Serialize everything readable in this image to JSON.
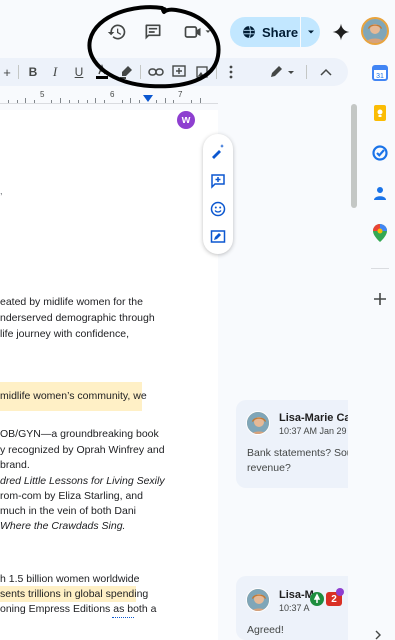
{
  "topbar": {
    "share_label": "Share",
    "icons": [
      "history-icon",
      "comment-icon",
      "video-icon",
      "sparkle-icon"
    ]
  },
  "toolbar": {
    "items": [
      "+",
      "B",
      "I",
      "U",
      "A",
      "highlighter",
      "link",
      "add-comment",
      "image",
      "more",
      "edit-mode",
      "collapse"
    ]
  },
  "ruler": {
    "numbers": [
      "5",
      "6",
      "7"
    ]
  },
  "floating_badge": "w",
  "document": {
    "lines": [
      {
        "text": "eated by midlife women for the",
        "highlight": false,
        "italic": false
      },
      {
        "text": "nderserved demographic through",
        "highlight": false,
        "italic": false
      },
      {
        "text": "life journey with confidence,",
        "highlight": false,
        "italic": false
      },
      {
        "text": " midlife women’s community, we",
        "highlight": true,
        "italic": false
      },
      {
        "text": " OB/GYN—a groundbreaking book",
        "highlight": false,
        "italic": false
      },
      {
        "text": "y recognized by Oprah Winfrey and",
        "highlight": false,
        "italic": false
      },
      {
        "text": "brand.",
        "highlight": false,
        "italic": false
      },
      {
        "text": "dred Little Lessons for Living Sexily",
        "highlight": false,
        "italic": true
      },
      {
        "text": " rom-com by Eliza Starling, and",
        "highlight": false,
        "italic": false
      },
      {
        "text": " much in the vein of both Dani",
        "highlight": false,
        "italic": false
      },
      {
        "text": "Where the Crawdads Sing.",
        "highlight": false,
        "italic": true
      },
      {
        "text": "h 1.5 billion women worldwide",
        "highlight": false,
        "italic": false
      },
      {
        "text": "sents trillions in global spending",
        "highlight": true,
        "italic": false
      },
      {
        "text": "oning Empress Editions as both a",
        "highlight": false,
        "italic": false
      }
    ]
  },
  "comments": [
    {
      "name": "Lisa-Marie Ca",
      "time": "10:37 AM Jan 29",
      "text_line1": "Bank statements? Sou",
      "text_line2": "revenue?"
    },
    {
      "name": "Lisa-M",
      "time": "10:37 A",
      "text_line1": "Agreed!",
      "text_line2": ""
    }
  ],
  "notification_count": "2",
  "colors": {
    "share_bg": "#c2e7ff",
    "highlight": "#fff0c6",
    "annotation": "#000000",
    "accent_blue": "#0b57d0"
  }
}
